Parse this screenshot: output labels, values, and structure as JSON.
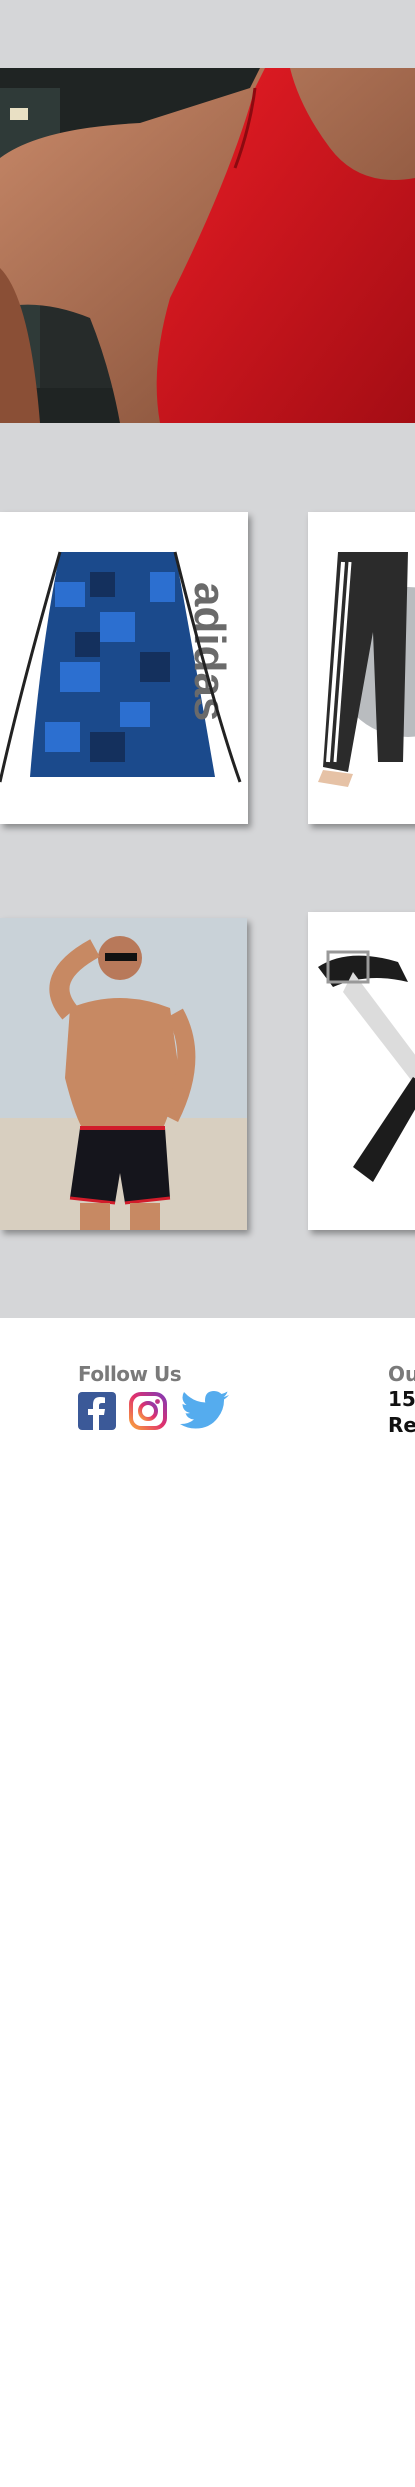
{
  "footer": {
    "follow_title": "Follow Us",
    "social_icons": [
      "facebook-icon",
      "instagram-icon",
      "twitter-icon"
    ],
    "our_title": "Ou",
    "our_lines": [
      "15",
      "Re"
    ]
  },
  "images": {
    "hero": "man in red tank top, back view",
    "products": [
      "blue camo adidas drawstring bag",
      "black track pants with white stripes and exercise ball",
      "man in black swim shorts on beach",
      "black lifting straps"
    ]
  },
  "colors": {
    "band": "#d5d6d8",
    "heading": "#7a7a7a",
    "facebook": "#3b5998",
    "twitter": "#55acee",
    "tank": "#d6121a"
  }
}
